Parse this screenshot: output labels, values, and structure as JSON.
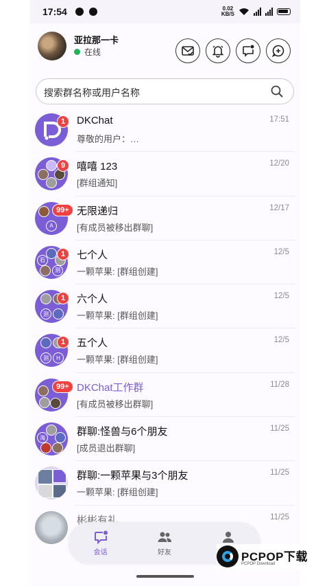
{
  "status_bar": {
    "time": "17:54",
    "net_speed": "0.02",
    "net_unit": "KB/S"
  },
  "profile": {
    "name": "亚拉那一卡",
    "status": "在线"
  },
  "header_icons": [
    "mail-check-icon",
    "bell-icon",
    "message-dot-icon",
    "add-chat-icon"
  ],
  "search": {
    "placeholder": "搜索群名称或用户名称"
  },
  "conversations": [
    {
      "title": "DKChat",
      "preview": "尊敬的用户：…",
      "time": "17:51",
      "badge": "1",
      "avatar": "dkchat-logo"
    },
    {
      "title": "嘻嘻 123",
      "preview": "[群组通知]",
      "time": "12/20",
      "badge": "9",
      "avatar": "group"
    },
    {
      "title": "无限递归",
      "preview": "[有成员被移出群聊]",
      "time": "12/17",
      "badge": "99+",
      "avatar": "group"
    },
    {
      "title": "七个人",
      "preview": "一颗苹果: [群组创建]",
      "time": "12/5",
      "badge": "1",
      "avatar": "group"
    },
    {
      "title": "六个人",
      "preview": "一颗苹果: [群组创建]",
      "time": "12/5",
      "badge": "1",
      "avatar": "group"
    },
    {
      "title": "五个人",
      "preview": "一颗苹果: [群组创建]",
      "time": "12/5",
      "badge": "1",
      "avatar": "group"
    },
    {
      "title": "DKChat工作群",
      "preview": "[有成员被移出群聊]",
      "time": "11/28",
      "badge": "99+",
      "avatar": "group"
    },
    {
      "title": "群聊:怪兽与6个朋友",
      "preview": "[成员退出群聊]",
      "time": "11/25",
      "badge": "",
      "avatar": "group"
    },
    {
      "title": "群聊:一颗苹果与3个朋友",
      "preview": "一颗苹果: [群组创建]",
      "time": "11/25",
      "badge": "",
      "avatar": "group"
    },
    {
      "title": "彬彬有礼",
      "preview": "",
      "time": "11/25",
      "badge": "",
      "avatar": "photo"
    }
  ],
  "bottom_nav": [
    {
      "label": "会话",
      "icon": "chat-icon",
      "active": true
    },
    {
      "label": "好友",
      "icon": "friends-icon",
      "active": false
    },
    {
      "label": "我的",
      "icon": "profile-icon",
      "active": false
    }
  ],
  "watermark": {
    "text": "PCPOP下载",
    "sub": "PCPOP Download"
  },
  "colors": {
    "accent": "#7b5ed6",
    "badge": "#f04040",
    "online": "#22b35a"
  }
}
